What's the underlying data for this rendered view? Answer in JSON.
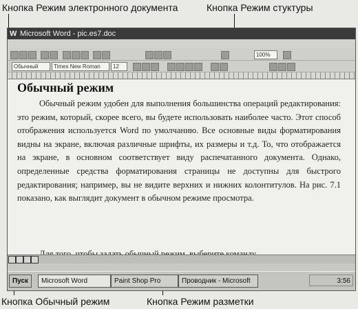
{
  "callouts": {
    "electronic_doc": "Кнопка Режим электронного документа",
    "structure": "Кнопка Режим стуктуры",
    "normal": "Кнопка Обычный режим",
    "layout": "Кнопка Режим разметки"
  },
  "window": {
    "title": "Microsoft Word - pic.es7.doc"
  },
  "toolbar": {
    "style": "Обычный",
    "font": "Times New Roman",
    "size": "12",
    "zoom": "100%"
  },
  "document": {
    "heading": "Обычный режим",
    "paragraph": "Обычный режим удобен для выполнения большинства операций редактирования: это режим, который, скорее всего, вы будете использовать наиболее часто. Этот способ отображения используется Word по умолчанию. Все основные виды форматирования видны на экране, включая различные шрифты, их размеры и т.д. То, что отображается на экране, в основном соответствует виду распечатанного документа. Однако, определенные средства форматирования страницы не доступны для быстрого редактирования; например, вы не видите верхних и нижних колонтитулов. На рис. 7.1 показано, как выглядит документ в обычном режиме просмотра.",
    "paragraph2": "Для того, чтобы задать обычный режим, выберите команду"
  },
  "taskbar": {
    "start": "Пуск",
    "tasks": [
      "Microsoft Word",
      "Paint Shop Pro",
      "Проводник - Microsoft"
    ],
    "clock": "3:56"
  },
  "colors": {
    "line": "#111111",
    "page": "#f0f0ec",
    "titlebar": "#3a3a3a"
  }
}
